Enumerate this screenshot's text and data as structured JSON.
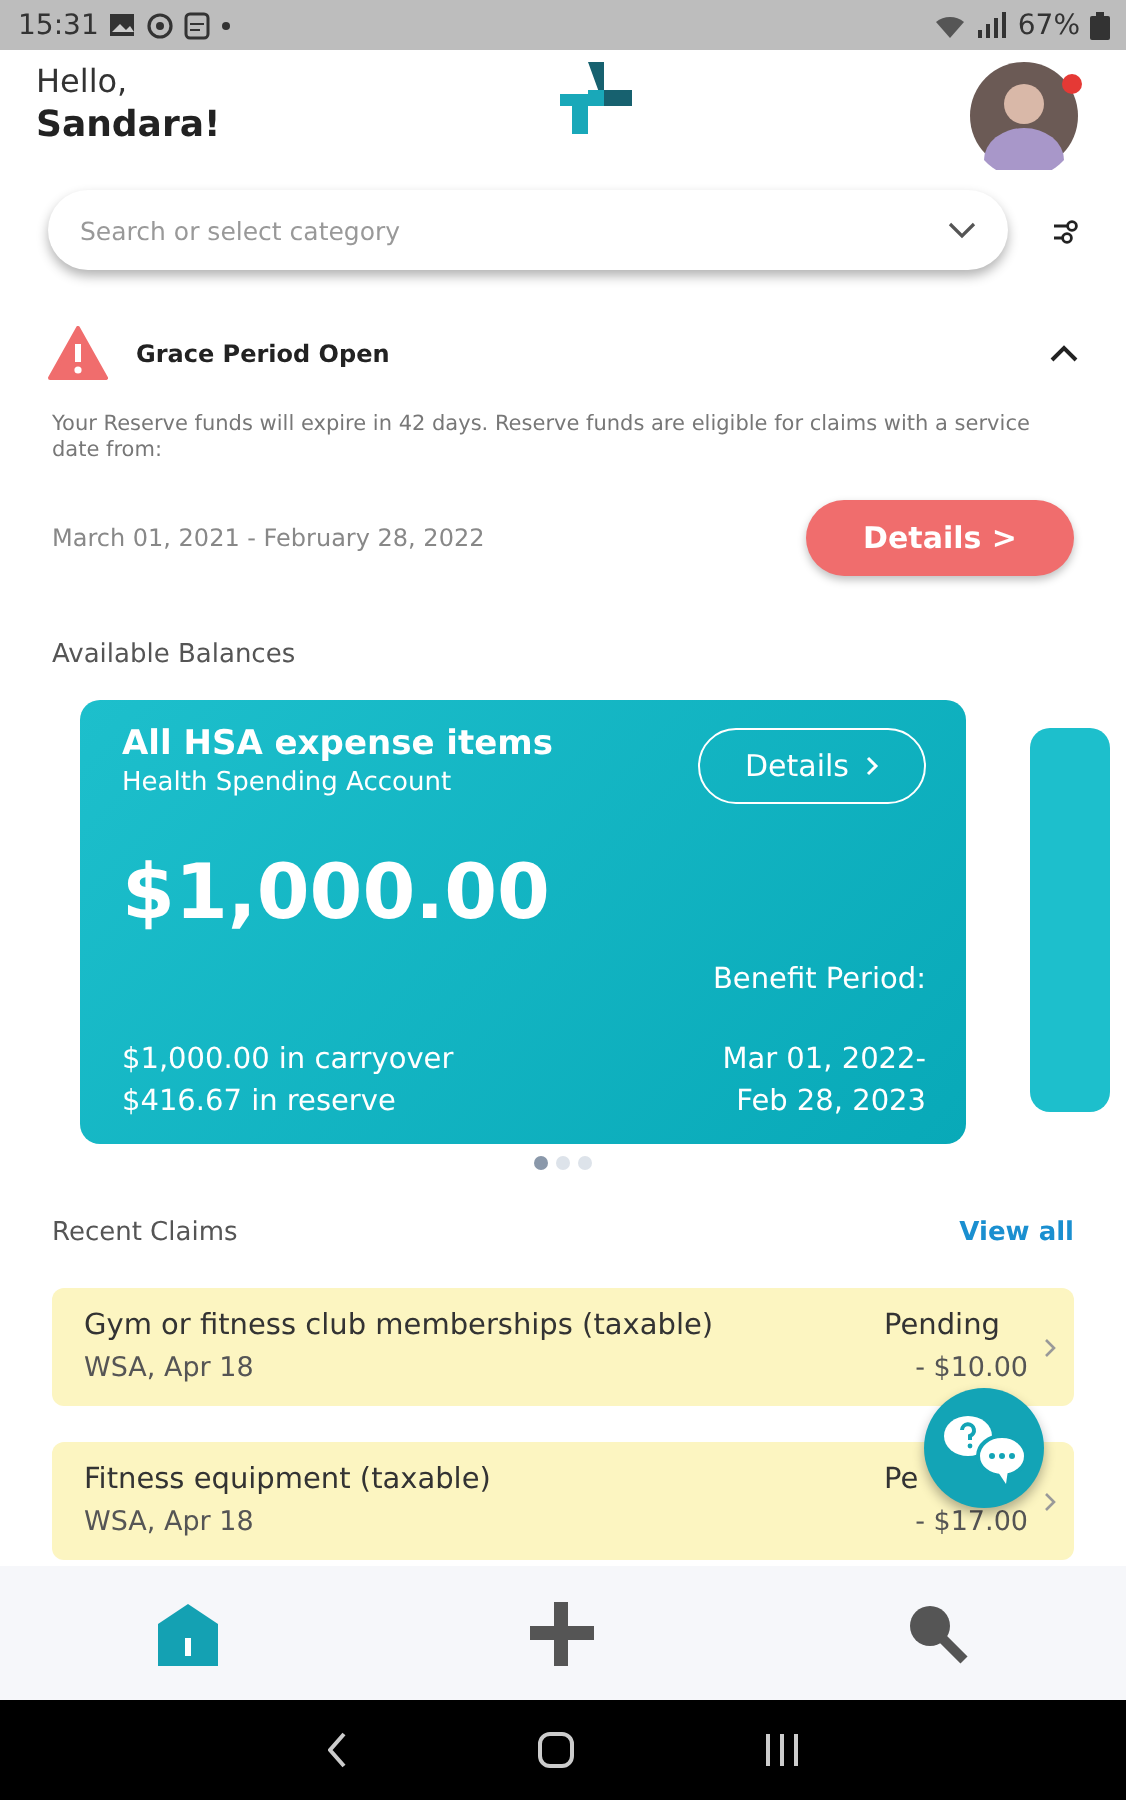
{
  "status_bar": {
    "time": "15:31",
    "battery": "67%"
  },
  "header": {
    "greeting": "Hello,",
    "name": "Sandara!",
    "notification": true
  },
  "search": {
    "placeholder": "Search or select category"
  },
  "alert": {
    "title": "Grace Period Open",
    "expanded": true,
    "message": "Your Reserve funds will expire in 42 days. Reserve funds are eligible for claims with a service date from:",
    "period": "March 01, 2021 - February 28, 2022",
    "button": "Details >"
  },
  "balances": {
    "heading": "Available Balances",
    "cards": [
      {
        "title": "All HSA expense items",
        "subtitle": "Health Spending Account",
        "button": "Details",
        "amount": "$1,000.00",
        "benefit_label": "Benefit Period:",
        "carryover": "$1,000.00 in carryover",
        "reserve": "$416.67 in reserve",
        "period_start": "Mar 01, 2022-",
        "period_end": "Feb 28, 2023"
      }
    ],
    "pages": [
      {
        "selected": true
      },
      {
        "selected": false
      },
      {
        "selected": false
      }
    ]
  },
  "claims": {
    "heading": "Recent Claims",
    "link": "View all",
    "items": [
      {
        "title": "Gym or fitness club memberships (taxable)",
        "meta": "WSA, Apr 18",
        "status": "Pending",
        "amount": "- $10.00"
      },
      {
        "title": "Fitness equipment (taxable)",
        "meta": "WSA, Apr 18",
        "status": "Pe",
        "amount": "- $17.00"
      }
    ]
  },
  "bottom_nav": [
    {
      "kind": "home",
      "selected": true
    },
    {
      "kind": "cross",
      "selected": false
    },
    {
      "kind": "search",
      "selected": false
    }
  ]
}
